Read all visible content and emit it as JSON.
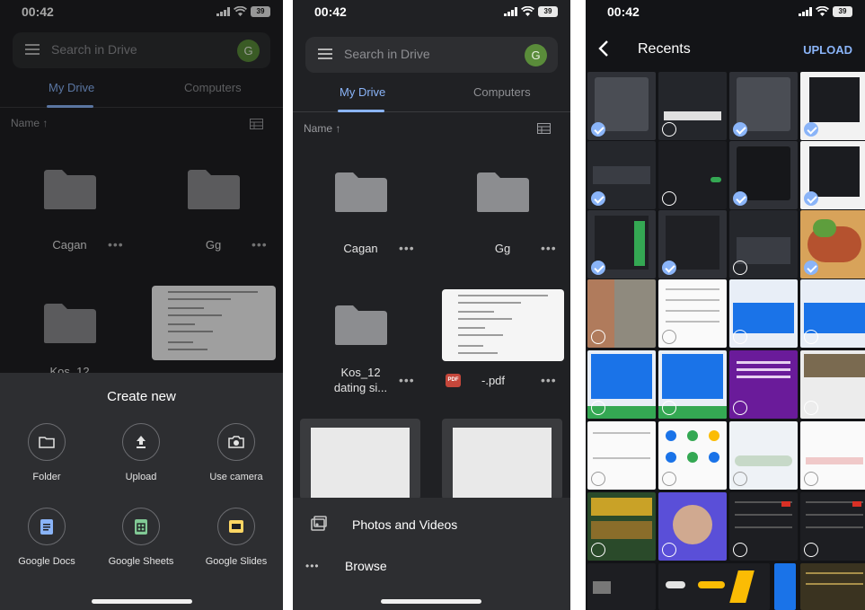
{
  "status_time": "00:42",
  "battery": "39",
  "drive": {
    "search_placeholder": "Search in Drive",
    "avatar_letter": "G",
    "tabs": [
      "My Drive",
      "Computers"
    ],
    "sort_label": "Name ↑",
    "items": {
      "cagan": "Cagan",
      "gg": "Gg",
      "kos_p1": "Kos_12",
      "kos_p2_line1": "Kos_12",
      "kos_p2_line2": "dating si...",
      "pdf_name": "-.pdf",
      "pdf_badge": "PDF"
    }
  },
  "create_sheet": {
    "title": "Create new",
    "actions": [
      "Folder",
      "Upload",
      "Use camera",
      "Google Docs",
      "Google Sheets",
      "Google Slides"
    ]
  },
  "upload_sheet": {
    "rows": [
      "Photos and Videos",
      "Browse"
    ]
  },
  "recents": {
    "title": "Recents",
    "upload_label": "UPLOAD",
    "colors": {
      "selected": "#8ab4f8",
      "accent_blue": "#1a73e8",
      "purple": "#6a1b9a"
    }
  }
}
